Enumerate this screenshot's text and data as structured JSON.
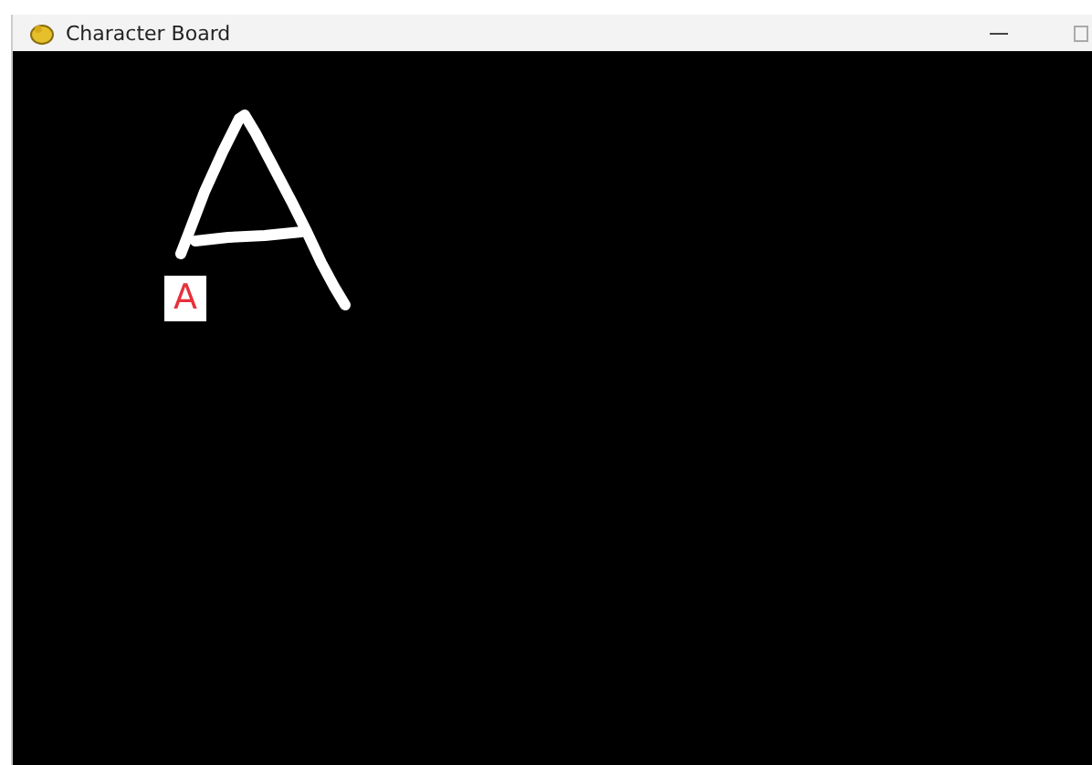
{
  "window": {
    "title": "Character Board"
  },
  "prediction": {
    "label": "A"
  }
}
